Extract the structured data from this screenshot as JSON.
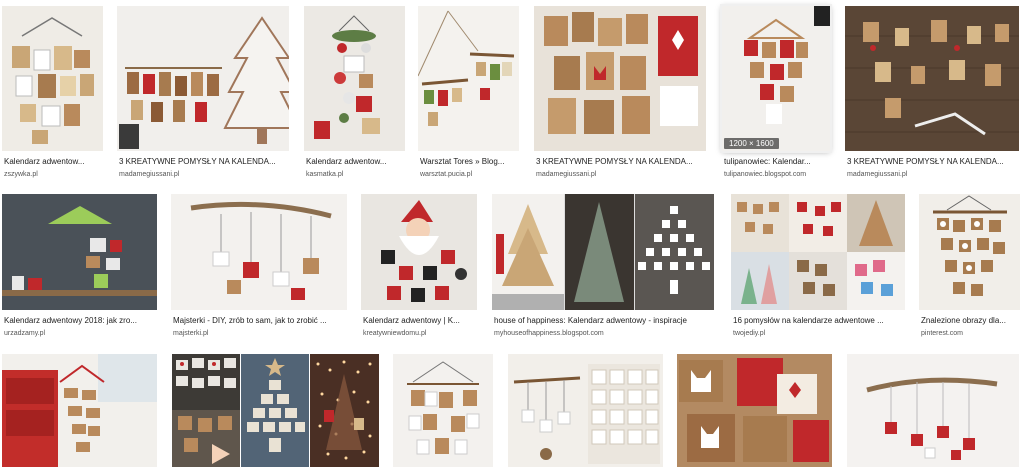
{
  "rows": [
    {
      "items": [
        {
          "caption": "Kalendarz adwentow...",
          "source": "zszywka.pl"
        },
        {
          "caption": "3 KREATYWNE POMYSŁY NA KALENDA...",
          "source": "madamegiussani.pl"
        },
        {
          "caption": "Kalendarz adwentow...",
          "source": "kasmatka.pl"
        },
        {
          "caption": "Warsztat Tores » Blog...",
          "source": "warsztat.pucia.pl"
        },
        {
          "caption": "3 KREATYWNE POMYSŁY NA KALENDA...",
          "source": "madamegiussani.pl"
        },
        {
          "caption": "tulipanowiec: Kalendar...",
          "source": "tulipanowiec.blogspot.com",
          "badge": "1200 × 1600"
        },
        {
          "caption": "3 KREATYWNE POMYSŁY NA KALENDA...",
          "source": "madamegiussani.pl"
        }
      ]
    },
    {
      "items": [
        {
          "caption": "Kalendarz adwentowy 2018: jak zro...",
          "source": "urzadzamy.pl"
        },
        {
          "caption": "Majsterki - DIY, zrób to sam, jak to zrobić ...",
          "source": "majsterki.pl"
        },
        {
          "caption": "Kalendarz adwentowy | K...",
          "source": "kreatywniewdomu.pl"
        },
        {
          "caption": "house of happiness: Kalendarz adwentowy - inspiracje",
          "source": "myhouseofhappiness.blogspot.com"
        },
        {
          "caption": "16 pomysłów na kalendarze adwentowe ...",
          "source": "twojediy.pl"
        },
        {
          "caption": "Znalezione obrazy dla...",
          "source": "pinterest.com"
        }
      ]
    },
    {
      "items": [
        {
          "caption": "",
          "source": ""
        },
        {
          "caption": "",
          "source": ""
        },
        {
          "caption": "",
          "source": ""
        },
        {
          "caption": "",
          "source": ""
        },
        {
          "caption": "",
          "source": ""
        },
        {
          "caption": "",
          "source": ""
        },
        {
          "caption": "",
          "source": ""
        }
      ]
    }
  ],
  "colors": {
    "kraft": "#b98a5c",
    "red": "#c0282b",
    "wall_light": "#e9e6e1",
    "wall_dark": "#4a4238",
    "wood": "#7a5634"
  }
}
